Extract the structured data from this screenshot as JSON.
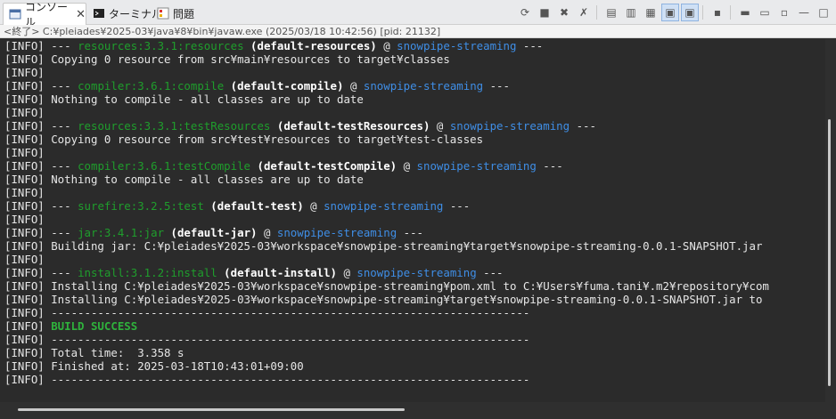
{
  "tabs": [
    {
      "label": "コンソール",
      "active": true,
      "icon": "console-icon"
    },
    {
      "label": "ターミナル",
      "active": false,
      "icon": "terminal-icon"
    },
    {
      "label": "問題",
      "active": false,
      "icon": "problems-icon"
    }
  ],
  "toolbar_icons": [
    "pin-icon",
    "stop-icon",
    "remove-launch-icon",
    "remove-all-icon",
    "clear-console-icon",
    "scroll-lock-icon",
    "word-wrap-icon",
    "show-on-output-icon",
    "show-on-error-icon",
    "save-icon",
    "open-console-icon",
    "display-console-icon",
    "new-console-icon",
    "minimize-icon",
    "maximize-icon"
  ],
  "status": "<終了> C:¥pleiades¥2025-03¥java¥8¥bin¥javaw.exe (2025/03/18 10:42:56) [pid: 21132]",
  "lines": [
    {
      "prefix": "[INFO] --- ",
      "plugin": "resources:3.3.1:resources",
      "exec": " (default-resources) ",
      "at": "@ ",
      "proj": "snowpipe-streaming",
      "suffix": " ---"
    },
    {
      "text": "[INFO] Copying 0 resource from src¥main¥resources to target¥classes"
    },
    {
      "text": "[INFO]"
    },
    {
      "prefix": "[INFO] --- ",
      "plugin": "compiler:3.6.1:compile",
      "exec": " (default-compile) ",
      "at": "@ ",
      "proj": "snowpipe-streaming",
      "suffix": " ---"
    },
    {
      "text": "[INFO] Nothing to compile - all classes are up to date"
    },
    {
      "text": "[INFO]"
    },
    {
      "prefix": "[INFO] --- ",
      "plugin": "resources:3.3.1:testResources",
      "exec": " (default-testResources) ",
      "at": "@ ",
      "proj": "snowpipe-streaming",
      "suffix": " ---"
    },
    {
      "text": "[INFO] Copying 0 resource from src¥test¥resources to target¥test-classes"
    },
    {
      "text": "[INFO]"
    },
    {
      "prefix": "[INFO] --- ",
      "plugin": "compiler:3.6.1:testCompile",
      "exec": " (default-testCompile) ",
      "at": "@ ",
      "proj": "snowpipe-streaming",
      "suffix": " ---"
    },
    {
      "text": "[INFO] Nothing to compile - all classes are up to date"
    },
    {
      "text": "[INFO]"
    },
    {
      "prefix": "[INFO] --- ",
      "plugin": "surefire:3.2.5:test",
      "exec": " (default-test) ",
      "at": "@ ",
      "proj": "snowpipe-streaming",
      "suffix": " ---"
    },
    {
      "text": "[INFO]"
    },
    {
      "prefix": "[INFO] --- ",
      "plugin": "jar:3.4.1:jar",
      "exec": " (default-jar) ",
      "at": "@ ",
      "proj": "snowpipe-streaming",
      "suffix": " ---"
    },
    {
      "text": "[INFO] Building jar: C:¥pleiades¥2025-03¥workspace¥snowpipe-streaming¥target¥snowpipe-streaming-0.0.1-SNAPSHOT.jar"
    },
    {
      "text": "[INFO]"
    },
    {
      "prefix": "[INFO] --- ",
      "plugin": "install:3.1.2:install",
      "exec": " (default-install) ",
      "at": "@ ",
      "proj": "snowpipe-streaming",
      "suffix": " ---"
    },
    {
      "text": "[INFO] Installing C:¥pleiades¥2025-03¥workspace¥snowpipe-streaming¥pom.xml to C:¥Users¥fuma.tani¥.m2¥repository¥com"
    },
    {
      "text": "[INFO] Installing C:¥pleiades¥2025-03¥workspace¥snowpipe-streaming¥target¥snowpipe-streaming-0.0.1-SNAPSHOT.jar to"
    },
    {
      "text": "[INFO] ------------------------------------------------------------------------"
    },
    {
      "prefix": "[INFO] ",
      "success": "BUILD SUCCESS"
    },
    {
      "text": "[INFO] ------------------------------------------------------------------------"
    },
    {
      "text": "[INFO] Total time:  3.358 s"
    },
    {
      "text": "[INFO] Finished at: 2025-03-18T10:43:01+09:00"
    },
    {
      "text": "[INFO] ------------------------------------------------------------------------"
    }
  ]
}
